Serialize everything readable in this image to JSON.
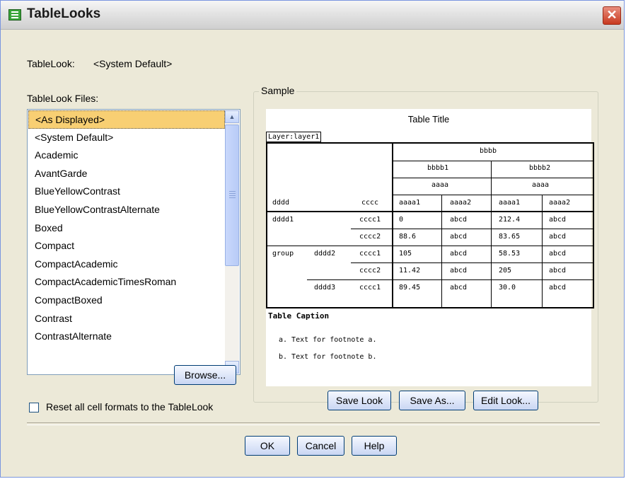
{
  "window": {
    "title": "TableLooks",
    "close_glyph": "✕"
  },
  "tablelook": {
    "label": "TableLook:",
    "value": "<System Default>"
  },
  "files": {
    "label": "TableLook Files:",
    "items": [
      "<As Displayed>",
      "<System Default>",
      "Academic",
      "AvantGarde",
      "BlueYellowContrast",
      "BlueYellowContrastAlternate",
      "Boxed",
      "Compact",
      "CompactAcademic",
      "CompactAcademicTimesRoman",
      "CompactBoxed",
      "Contrast",
      "ContrastAlternate"
    ],
    "selected_index": 0
  },
  "browse_label": "Browse...",
  "reset": {
    "label": "Reset all cell formats to the TableLook",
    "checked": false
  },
  "sample": {
    "group_label": "Sample",
    "table_title": "Table Title",
    "layer": "Layer:layer1",
    "caption": "Table Caption",
    "headers": {
      "top": "bbbb",
      "sub1": "bbbb1",
      "sub2": "bbbb2",
      "aaaa_left": "aaaa",
      "aaaa_right": "aaaa",
      "row_dim": "dddd",
      "cccc": "cccc",
      "col1": "aaaa1",
      "col2": "aaaa2",
      "col3": "aaaa1",
      "col4": "aaaa2"
    },
    "rows": [
      {
        "group": "",
        "d1": "dddd1",
        "d2": "",
        "c": "cccc1",
        "v": [
          "0",
          "abcd",
          "212.4",
          "abcd"
        ]
      },
      {
        "group": "",
        "d1": "",
        "d2": "",
        "c": "cccc2",
        "v": [
          "88.6",
          "abcd",
          "83.65",
          "abcd"
        ]
      },
      {
        "group": "group",
        "d1": "",
        "d2": "dddd2",
        "c": "cccc1",
        "v": [
          "105",
          "abcd",
          "58.53",
          "abcd"
        ]
      },
      {
        "group": "",
        "d1": "",
        "d2": "",
        "c": "cccc2",
        "v": [
          "11.42",
          "abcd",
          "205",
          "abcd"
        ]
      },
      {
        "group": "",
        "d1": "",
        "d2": "dddd3",
        "c": "cccc1",
        "v": [
          "89.45",
          "abcd",
          "30.0",
          "abcd"
        ]
      }
    ],
    "footnotes": [
      "a. Text for footnote a.",
      "b. Text for footnote b."
    ]
  },
  "buttons": {
    "save_look": "Save Look",
    "save_as": "Save As...",
    "edit_look": "Edit Look...",
    "ok": "OK",
    "cancel": "Cancel",
    "help": "Help"
  },
  "colors": {
    "selection": "#f8cf73",
    "dialog_bg": "#ECE9D8",
    "button_border": "#003c74"
  }
}
